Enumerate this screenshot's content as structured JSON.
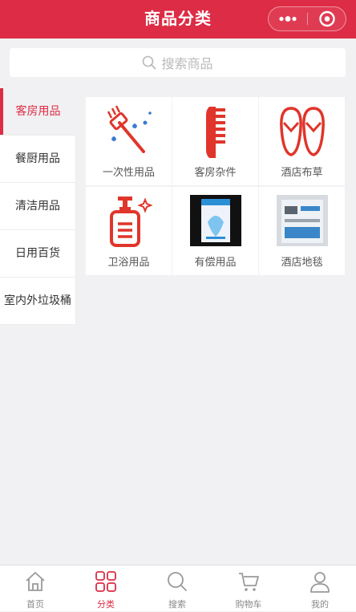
{
  "header": {
    "title": "商品分类"
  },
  "search": {
    "placeholder": "搜索商品"
  },
  "sidebar": {
    "items": [
      {
        "label": "客房用品",
        "active": true
      },
      {
        "label": "餐厨用品",
        "active": false
      },
      {
        "label": "清洁用品",
        "active": false
      },
      {
        "label": "日用百货",
        "active": false
      },
      {
        "label": "室内外垃圾桶",
        "active": false
      }
    ]
  },
  "categories": [
    {
      "label": "一次性用品",
      "icon": "toothbrush-icon"
    },
    {
      "label": "客房杂件",
      "icon": "comb-icon"
    },
    {
      "label": "酒店布草",
      "icon": "slippers-icon"
    },
    {
      "label": "卫浴用品",
      "icon": "soap-dispenser-icon"
    },
    {
      "label": "有偿用品",
      "icon": "product-box-image"
    },
    {
      "label": "酒店地毯",
      "icon": "carpet-box-image"
    }
  ],
  "tabbar": {
    "items": [
      {
        "label": "首页",
        "icon": "home-icon",
        "active": false
      },
      {
        "label": "分类",
        "icon": "category-grid-icon",
        "active": true
      },
      {
        "label": "搜索",
        "icon": "search-icon",
        "active": false
      },
      {
        "label": "购物车",
        "icon": "cart-icon",
        "active": false
      },
      {
        "label": "我的",
        "icon": "user-icon",
        "active": false
      }
    ]
  },
  "colors": {
    "accent": "#dd2c45",
    "background": "#f1f1f3",
    "tab_inactive": "#888888"
  }
}
